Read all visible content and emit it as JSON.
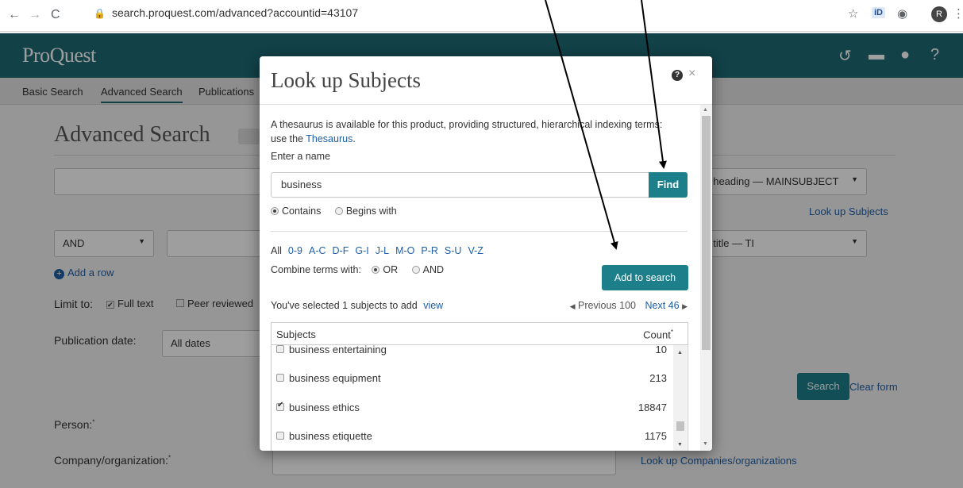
{
  "browser": {
    "back": "←",
    "forward": "→",
    "reload": "C",
    "url": "search.proquest.com/advanced?accountid=43107",
    "id_badge": "iD",
    "avatar": "R"
  },
  "header": {
    "logo": "ProQuest"
  },
  "nav": {
    "basic": "Basic Search",
    "advanced": "Advanced Search",
    "publications": "Publications"
  },
  "page": {
    "title": "Advanced Search",
    "subject_heading": "t heading — MAINSUBJECT",
    "lookup_subjects": "Look up Subjects",
    "and_op": "AND",
    "doc_title": "t title — TI",
    "add_row": "Add a row",
    "limit_to": "Limit to:",
    "full_text": "Full text",
    "peer_reviewed": "Peer reviewed",
    "pub_date": "Publication date:",
    "all_dates": "All dates",
    "search_btn": "Search",
    "clear_form": "Clear form",
    "person": "Person:",
    "company": "Company/organization:",
    "lookup_companies": "Look up Companies/organizations"
  },
  "modal": {
    "title": "Look up Subjects",
    "help": "?",
    "close": "×",
    "desc_prefix": "A thesaurus is available for this product, providing structured, hierarchical indexing terms: use the ",
    "desc_link": "Thesaurus",
    "desc_suffix": ".",
    "enter_name": "Enter a name",
    "input_value": "business",
    "find": "Find",
    "contains": "Contains",
    "begins_with": "Begins with",
    "alpha": [
      "All",
      "0-9",
      "A-C",
      "D-F",
      "G-I",
      "J-L",
      "M-O",
      "P-R",
      "S-U",
      "V-Z"
    ],
    "combine_label": "Combine terms with:",
    "or": "OR",
    "and": "AND",
    "add_to_search": "Add to search",
    "selected_text": "You've selected 1 subjects to add",
    "view": "view",
    "previous": "Previous 100",
    "next": "Next 46",
    "col_subjects": "Subjects",
    "col_count": "Count",
    "rows": [
      {
        "name": "business entertaining",
        "count": "10"
      },
      {
        "name": "business equipment",
        "count": "213"
      },
      {
        "name": "business ethics",
        "count": "18847"
      },
      {
        "name": "business etiquette",
        "count": "1175"
      }
    ]
  }
}
